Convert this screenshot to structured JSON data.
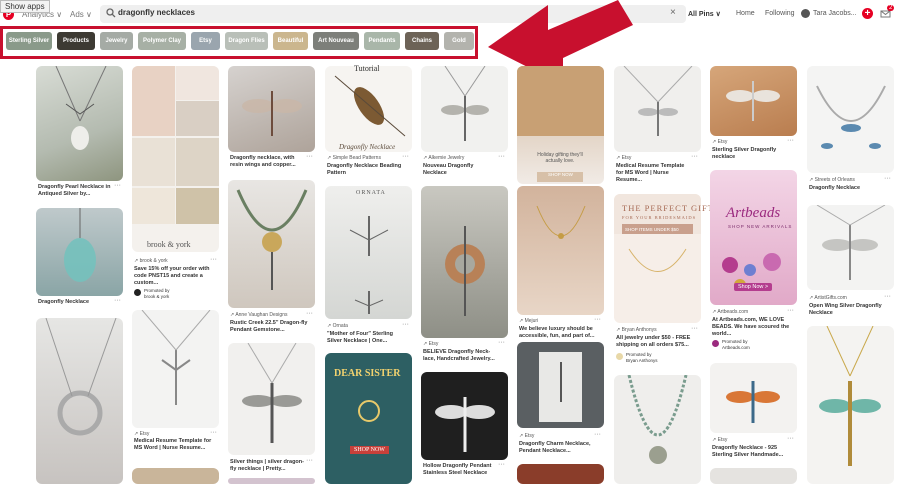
{
  "tooltip": "Show apps",
  "topbar": {
    "logo": "P",
    "analytics": "Analytics ∨",
    "ads": "Ads ∨",
    "search_value": "dragonfly necklaces",
    "clear": "×",
    "all_pins": "All Pins ∨",
    "home": "Home",
    "following": "Following",
    "user": "Tara Jacobs...",
    "add": "+",
    "notif_count": "2"
  },
  "guides": [
    {
      "label": "Sterling Silver",
      "color": "#8a9a8a"
    },
    {
      "label": "Products",
      "color": "#3d3a33"
    },
    {
      "label": "Jewelry",
      "color": "#a5aba5"
    },
    {
      "label": "Polymer Clay",
      "color": "#a7b0a5"
    },
    {
      "label": "Etsy",
      "color": "#9aa5ae"
    },
    {
      "label": "Dragon Flies",
      "color": "#b9bfb8"
    },
    {
      "label": "Beautiful",
      "color": "#cbb68e"
    },
    {
      "label": "Art Nouveau",
      "color": "#7d7f7a"
    },
    {
      "label": "Pendants",
      "color": "#a9b6a9"
    },
    {
      "label": "Chains",
      "color": "#6d6357"
    },
    {
      "label": "Gold",
      "color": "#b3b3ad"
    }
  ],
  "pins": {
    "c1": {
      "t1": "Dragonfly Pearl Necklace in Antiqued Silver by...",
      "t2": "Dragonfly Necklace"
    },
    "c2": {
      "brand": "brook & york",
      "src1": "brook & york",
      "t1": "Save 15% off your order with code PNST15 and create a custom...",
      "promoted": "Promoted by",
      "promoted_by": "brook & york",
      "src2": "Etsy",
      "t2": "Medical Resume Template for MS Word | Nurse Resume..."
    },
    "c3": {
      "t1": "Dragonfly necklace, with resin wings and copper...",
      "src2": "Anne Vaughan Designs",
      "t2": "Rustic Creek 22.5\" Dragon-fly Pendant Gemstone...",
      "t3": "Silver things | silver dragon-fly necklace | Pretty..."
    },
    "c4": {
      "overlay_top": "Tutorial",
      "overlay_bottom": "Dragonfly Necklace",
      "src1": "Simple Bead Patterns",
      "t1": "Dragonfly Necklace Beading Pattern",
      "ornata_logo": "ORNATA",
      "src2": "Ornata",
      "t2": "\"Mother of Four\" Sterling Silver Necklace | One...",
      "dear_sister": "DEAR SISTER",
      "shop_now": "SHOP NOW"
    },
    "c5": {
      "src1": "Alkemie Jewelry",
      "t1": "Nouveau Dragonfly Necklace",
      "src2": "Etsy",
      "t2": "BELIEVE Dragonfly Neck-lace, Handcrafted Jewelry...",
      "t3": "Hollow Dragonfly Pendant Stainless Steel Necklace"
    },
    "c6": {
      "ad_text": "Holiday gifting they'll actually love.",
      "ad_btn": "SHOP NOW",
      "src1": "Mejuri",
      "t1": "We believe luxury should be accessible, fun, and part of...",
      "promoted": "Promoted by",
      "promoted_by": "Mejuri",
      "src2": "Etsy",
      "t2": "Dragonfly Charm Necklace, Pendant Necklace..."
    },
    "c7": {
      "src1": "Etsy",
      "t1": "Medical Resume Template for MS Word | Nurse Resume...",
      "ad_title": "THE PERFECT GIFT",
      "ad_sub": "FOR YOUR BRIDESMAIDS",
      "ad_btn": "SHOP ITEMS UNDER $50",
      "src2": "Bryan Anthonys",
      "t2": "All jewelry under $50 - FREE shipping on all orders $75...",
      "promoted": "Promoted by",
      "promoted_by": "Bryan Anthonys"
    },
    "c8": {
      "src1": "Etsy",
      "t1": "Sterling Silver Dragonfly necklace",
      "art_title": "Artbeads",
      "art_sub": "SHOP NEW ARRIVALS",
      "art_btn": "Shop Now >",
      "src2": "Artbeads.com",
      "t2": "At Artbeads.com, WE LOVE BEADS. We have scoured the world...",
      "promoted": "Promoted by",
      "promoted_by": "Artbeads.com",
      "src3": "Etsy",
      "t3": "Dragonfly Necklace - 925 Sterling Silver Handmade..."
    },
    "c9": {
      "src1": "Streets of Orleans",
      "t1": "Dragonfly Necklace",
      "src2": "ArtistGifts.com",
      "t2": "Open Wing Silver Dragonfly Necklace"
    }
  }
}
